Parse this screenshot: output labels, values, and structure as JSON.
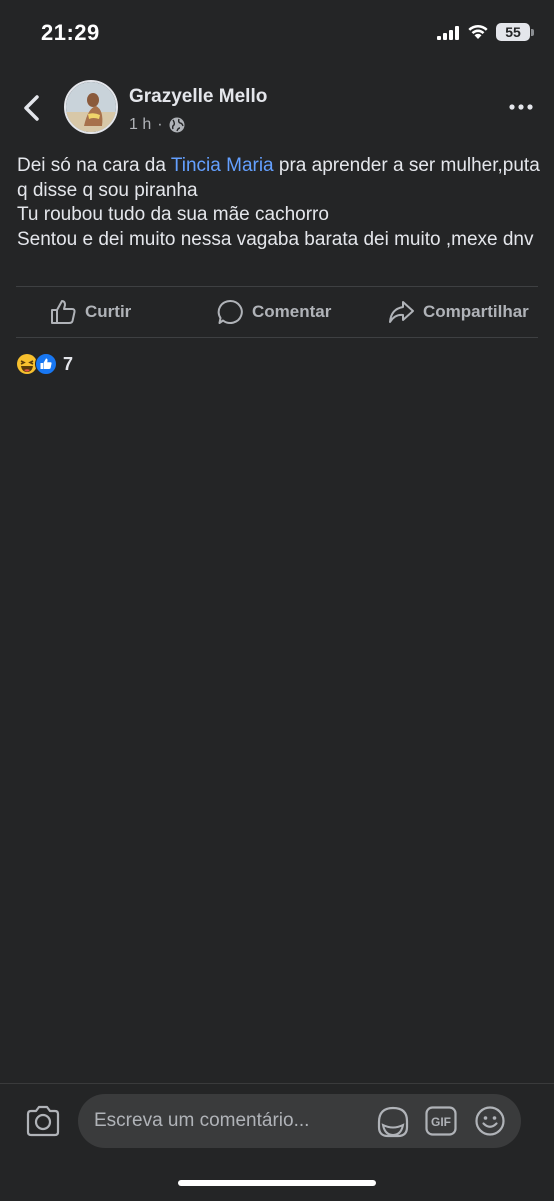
{
  "status_bar": {
    "time": "21:29",
    "battery": "55"
  },
  "post": {
    "author": "Grazyelle Mello",
    "time_ago": "1 h",
    "privacy_icon": "globe-icon",
    "text_line1_before": "Dei só na cara da ",
    "mention": "Tincia Maria",
    "text_line1_after": " pra aprender a ser mulher,puta q disse q sou piranha",
    "text_line2": "Tu roubou tudo da sua mãe cachorro",
    "text_line3": "Sentou e dei muito nessa vagaba barata dei muito ,mexe dnv"
  },
  "actions": {
    "like": "Curtir",
    "comment": "Comentar",
    "share": "Compartilhar"
  },
  "reactions": {
    "types": [
      "haha",
      "like"
    ],
    "count": "7"
  },
  "comment_bar": {
    "placeholder": "Escreva um comentário...",
    "gif_label": "GIF"
  },
  "colors": {
    "background": "#242526",
    "mention": "#64a0ff",
    "like_blue": "#1877f2",
    "haha_yellow": "#f7c02e"
  }
}
